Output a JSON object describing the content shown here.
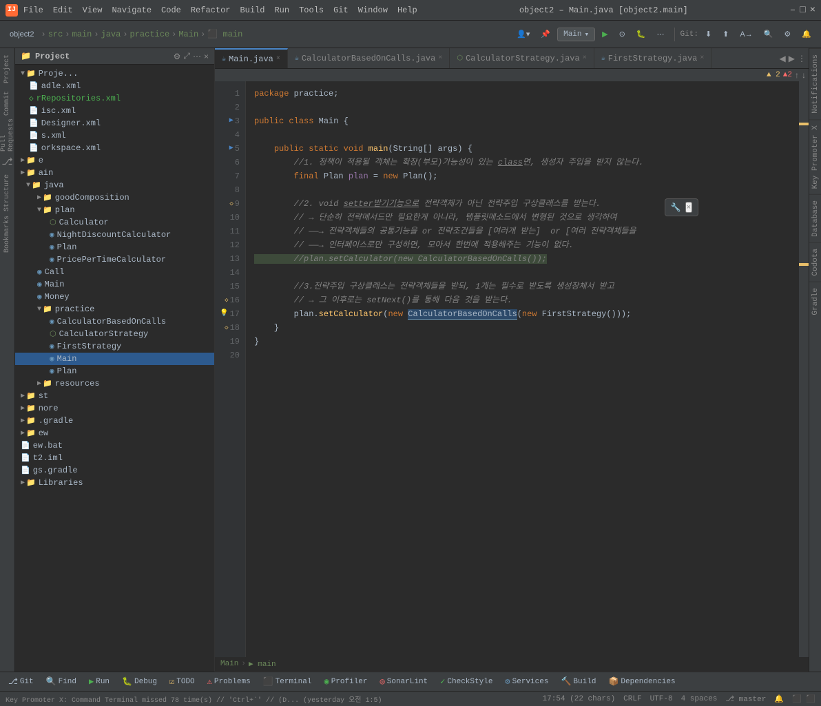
{
  "titleBar": {
    "logo": "IJ",
    "menus": [
      "File",
      "Edit",
      "View",
      "Navigate",
      "Code",
      "Refactor",
      "Build",
      "Run",
      "Tools",
      "Git",
      "Window",
      "Help"
    ],
    "title": "object2 – Main.java [object2.main]",
    "controls": [
      "–",
      "□",
      "×"
    ]
  },
  "toolbar": {
    "breadcrumb": [
      "object2",
      ">",
      "src",
      ">",
      "main",
      ">",
      "java",
      ">",
      "practice",
      ">",
      "Main",
      ">",
      "main"
    ],
    "runConfig": "Main",
    "gitLabel": "Git:"
  },
  "projectPanel": {
    "title": "Project",
    "treeItems": [
      {
        "id": "proj",
        "label": "Proje...",
        "indent": 0,
        "type": "project",
        "expanded": true
      },
      {
        "id": "adle",
        "label": "adle.xml",
        "indent": 1,
        "type": "xml"
      },
      {
        "id": "rrepo",
        "label": "rRepositories.xml",
        "indent": 1,
        "type": "xml-special"
      },
      {
        "id": "isc",
        "label": "isc.xml",
        "indent": 1,
        "type": "xml"
      },
      {
        "id": "designer",
        "label": "Designer.xml",
        "indent": 1,
        "type": "xml"
      },
      {
        "id": "s",
        "label": "s.xml",
        "indent": 1,
        "type": "xml"
      },
      {
        "id": "workspace",
        "label": "orkspace.xml",
        "indent": 1,
        "type": "xml"
      },
      {
        "id": "e",
        "label": "e",
        "indent": 0,
        "type": "folder"
      },
      {
        "id": "ain",
        "label": "ain",
        "indent": 0,
        "type": "folder"
      },
      {
        "id": "java",
        "label": "java",
        "indent": 1,
        "type": "folder-src",
        "expanded": true
      },
      {
        "id": "goodComp",
        "label": "goodComposition",
        "indent": 2,
        "type": "folder"
      },
      {
        "id": "plan",
        "label": "plan",
        "indent": 2,
        "type": "folder",
        "expanded": true
      },
      {
        "id": "Calculator",
        "label": "Calculator",
        "indent": 3,
        "type": "class-iface"
      },
      {
        "id": "NightDisc",
        "label": "NightDiscountCalculator",
        "indent": 3,
        "type": "class"
      },
      {
        "id": "Plan",
        "label": "Plan",
        "indent": 3,
        "type": "class"
      },
      {
        "id": "PricePerTime",
        "label": "PricePerTimeCalculator",
        "indent": 3,
        "type": "class"
      },
      {
        "id": "Call",
        "label": "Call",
        "indent": 2,
        "type": "class"
      },
      {
        "id": "Main2",
        "label": "Main",
        "indent": 2,
        "type": "class"
      },
      {
        "id": "Money",
        "label": "Money",
        "indent": 2,
        "type": "class"
      },
      {
        "id": "practice",
        "label": "practice",
        "indent": 2,
        "type": "folder",
        "expanded": true
      },
      {
        "id": "CalcBased",
        "label": "CalculatorBasedOnCalls",
        "indent": 3,
        "type": "class"
      },
      {
        "id": "CalcStrat",
        "label": "CalculatorStrategy",
        "indent": 3,
        "type": "class-iface"
      },
      {
        "id": "FirstStrat",
        "label": "FirstStrategy",
        "indent": 3,
        "type": "class"
      },
      {
        "id": "MainPrac",
        "label": "Main",
        "indent": 3,
        "type": "class",
        "selected": true
      },
      {
        "id": "PlanPrac",
        "label": "Plan",
        "indent": 3,
        "type": "class"
      },
      {
        "id": "resources",
        "label": "resources",
        "indent": 2,
        "type": "folder"
      },
      {
        "id": "st",
        "label": "st",
        "indent": 0,
        "type": "folder"
      },
      {
        "id": "nore",
        "label": "nore",
        "indent": 0,
        "type": "folder"
      },
      {
        "id": "gradle",
        "label": ".gradle",
        "indent": 0,
        "type": "folder"
      },
      {
        "id": "ew",
        "label": "ew",
        "indent": 0,
        "type": "folder"
      },
      {
        "id": "ewbat",
        "label": "ew.bat",
        "indent": 0,
        "type": "file"
      },
      {
        "id": "t2iml",
        "label": "t2.iml",
        "indent": 0,
        "type": "file"
      },
      {
        "id": "gsgradle",
        "label": "gs.gradle",
        "indent": 0,
        "type": "file"
      },
      {
        "id": "Libraries",
        "label": "Libraries",
        "indent": 0,
        "type": "folder"
      }
    ]
  },
  "tabs": [
    {
      "id": "main-java",
      "label": "Main.java",
      "type": "java",
      "active": true
    },
    {
      "id": "calc-based",
      "label": "CalculatorBasedOnCalls.java",
      "type": "java",
      "active": false
    },
    {
      "id": "calc-strat",
      "label": "CalculatorStrategy.java",
      "type": "iface",
      "active": false
    },
    {
      "id": "first-strat",
      "label": "FirstStrategy.java",
      "type": "java",
      "active": false
    }
  ],
  "warningBar": {
    "warningCount": "▲ 2",
    "errorCount": "▲2",
    "upArrow": "↑",
    "downArrow": "↓"
  },
  "editorBreadcrumb": {
    "items": [
      "Main",
      "▶ main"
    ]
  },
  "codeLines": [
    {
      "num": 1,
      "content": "package practice;",
      "tokens": [
        {
          "t": "kw",
          "v": "package"
        },
        {
          "t": "plain",
          "v": " practice;"
        }
      ]
    },
    {
      "num": 2,
      "content": "",
      "tokens": []
    },
    {
      "num": 3,
      "content": "public class Main {",
      "tokens": [
        {
          "t": "kw",
          "v": "public"
        },
        {
          "t": "plain",
          "v": " "
        },
        {
          "t": "kw",
          "v": "class"
        },
        {
          "t": "plain",
          "v": " Main {"
        }
      ],
      "hasArrow": true
    },
    {
      "num": 4,
      "content": "",
      "tokens": []
    },
    {
      "num": 5,
      "content": "    public static void main(String[] args) {",
      "tokens": [
        {
          "t": "kw",
          "v": "    public"
        },
        {
          "t": "plain",
          "v": " "
        },
        {
          "t": "kw",
          "v": "static"
        },
        {
          "t": "plain",
          "v": " "
        },
        {
          "t": "kw",
          "v": "void"
        },
        {
          "t": "plain",
          "v": " "
        },
        {
          "t": "method",
          "v": "main"
        },
        {
          "t": "plain",
          "v": "(String[] args) {"
        }
      ],
      "hasArrow": true
    },
    {
      "num": 6,
      "content": "        //1. 정책이 적용될 객체는 확장(부모)가능성이 있는 class면, 생성자 주입을 받지 않는다.",
      "tokens": [
        {
          "t": "comment",
          "v": "        //1. 정책이 적용될 객체는 확장(부모)가능성이 있는 class면, 생성자 주입을 받지 않는다."
        }
      ]
    },
    {
      "num": 7,
      "content": "        final Plan plan = new Plan();",
      "tokens": [
        {
          "t": "plain",
          "v": "        "
        },
        {
          "t": "kw",
          "v": "final"
        },
        {
          "t": "plain",
          "v": " Plan "
        },
        {
          "t": "var",
          "v": "plan"
        },
        {
          "t": "plain",
          "v": " = "
        },
        {
          "t": "kw",
          "v": "new"
        },
        {
          "t": "plain",
          "v": " Plan();"
        }
      ]
    },
    {
      "num": 8,
      "content": "",
      "tokens": []
    },
    {
      "num": 9,
      "content": "        //2. void setter받기기능으로 전략객체가 아닌 전략주입 구상클래스를 받는다.",
      "tokens": [
        {
          "t": "comment",
          "v": "        //2. void setter받기기능으로 전략객체가 아닌 전략주입 구상클래스를 받는다."
        }
      ],
      "hasWarning": true
    },
    {
      "num": 10,
      "content": "        // → 단순히 전략메서드만 필요한게 아니라, 템플릿메소드에서 변형된 것으로 생각하여",
      "tokens": [
        {
          "t": "comment",
          "v": "        // → 단순히 전략메서드만 필요한게 아니라, 템플릿메소드에서 변형된 것으로 생각하여"
        }
      ]
    },
    {
      "num": 11,
      "content": "        // —→ 전략객체들의 공통기능을 or 전략조건들을 [여러개 받는]  or [여러 전략객체들을",
      "tokens": [
        {
          "t": "comment",
          "v": "        // —→ 전략객체들의 공통기능을 or 전략조건들을 [여러개 받는]  or [여러 전략객체들을"
        }
      ]
    },
    {
      "num": 12,
      "content": "        // —→ 인터페이스로만 구성하면, 모아서 한번에 적용해주는 기능이 없다.",
      "tokens": [
        {
          "t": "comment",
          "v": "        // —→ 인터페이스로만 구성하면, 모아서 한번에 적용해주는 기능이 없다."
        }
      ]
    },
    {
      "num": 13,
      "content": "        //plan.setCalculator(new CalculatorBasedOnCalls());",
      "tokens": [
        {
          "t": "comment-hi",
          "v": "        //plan.setCalculator(new CalculatorBasedOnCalls());"
        }
      ]
    },
    {
      "num": 14,
      "content": "",
      "tokens": []
    },
    {
      "num": 15,
      "content": "        //3.전략주입 구상클래스는 전략객체들을 받되, 1개는 필수로 받도록 생성장체서 받고",
      "tokens": [
        {
          "t": "comment",
          "v": "        //3.전략주입 구상클래스는 전략객체들을 받되, 1개는 필수로 받도록 생성장체서 받고"
        }
      ]
    },
    {
      "num": 16,
      "content": "        // → 그 이후로는 setNext()를 통해 다음 것을 받는다.",
      "tokens": [
        {
          "t": "comment",
          "v": "        // → 그 이후로는 setNext()를 통해 다음 것을 받는다."
        }
      ],
      "hasWarning2": true
    },
    {
      "num": 17,
      "content": "        plan.setCalculator(new CalculatorBasedOnCalls(new FirstStrategy()));",
      "tokens": [
        {
          "t": "plain",
          "v": "        plan."
        },
        {
          "t": "method",
          "v": "setCalculator"
        },
        {
          "t": "plain",
          "v": "("
        },
        {
          "t": "kw",
          "v": "new"
        },
        {
          "t": "plain",
          "v": " "
        },
        {
          "t": "highlight",
          "v": "CalculatorBasedOnCalls"
        },
        {
          "t": "plain",
          "v": "("
        },
        {
          "t": "kw",
          "v": "new"
        },
        {
          "t": "plain",
          "v": " FirstStrategy()));"
        }
      ],
      "hasBulb": true
    },
    {
      "num": 18,
      "content": "    }",
      "tokens": [
        {
          "t": "plain",
          "v": "    }"
        }
      ],
      "hasWarning3": true
    },
    {
      "num": 19,
      "content": "}",
      "tokens": [
        {
          "t": "plain",
          "v": "}"
        }
      ]
    },
    {
      "num": 20,
      "content": "",
      "tokens": []
    }
  ],
  "popup": {
    "icon": "🔧",
    "text": "×"
  },
  "rightPanels": [
    "Notifications",
    "Key Promoter X",
    "Database",
    "Codota",
    "Gradle"
  ],
  "statusBar": {
    "keyPromoter": "Key Promoter X: Command Terminal missed 78 time(s) // 'Ctrl+`' // (D... (yesterday 오전 1:5)",
    "position": "17:54 (22 chars)",
    "lineEnding": "CRLF",
    "encoding": "UTF-8",
    "indent": "4 spaces",
    "git": "master"
  },
  "bottomToolbar": {
    "buttons": [
      {
        "id": "git",
        "icon": "⎇",
        "label": "Git"
      },
      {
        "id": "find",
        "icon": "🔍",
        "label": "Find"
      },
      {
        "id": "run",
        "icon": "▶",
        "label": "Run"
      },
      {
        "id": "debug",
        "icon": "🐛",
        "label": "Debug"
      },
      {
        "id": "todo",
        "icon": "☑",
        "label": "TODO"
      },
      {
        "id": "problems",
        "icon": "⚠",
        "label": "Problems"
      },
      {
        "id": "terminal",
        "icon": "⬛",
        "label": "Terminal"
      },
      {
        "id": "profiler",
        "icon": "◉",
        "label": "Profiler"
      },
      {
        "id": "sonar",
        "icon": "◎",
        "label": "SonarLint"
      },
      {
        "id": "checkstyle",
        "icon": "✓",
        "label": "CheckStyle"
      },
      {
        "id": "services",
        "icon": "⚙",
        "label": "Services"
      },
      {
        "id": "build",
        "icon": "🔨",
        "label": "Build"
      },
      {
        "id": "deps",
        "icon": "📦",
        "label": "Dependencies"
      }
    ]
  }
}
